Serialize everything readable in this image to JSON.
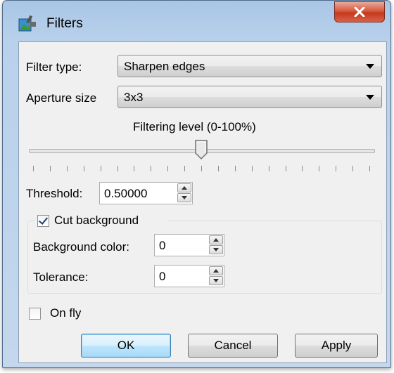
{
  "window": {
    "title": "Filters",
    "close_glyph": "X"
  },
  "filter_type": {
    "label": "Filter type:",
    "value": "Sharpen edges"
  },
  "aperture": {
    "label": "Aperture size",
    "value": "3x3"
  },
  "filtering_level": {
    "label": "Filtering level (0-100%)",
    "value_percent": 50,
    "tick_count": 20
  },
  "threshold": {
    "label": "Threshold:",
    "value": "0.50000"
  },
  "cut_background": {
    "label": "Cut background",
    "checked": true,
    "background_color": {
      "label": "Background color:",
      "value": "0"
    },
    "tolerance": {
      "label": "Tolerance:",
      "value": "0"
    }
  },
  "on_fly": {
    "label": "On fly",
    "checked": false
  },
  "buttons": {
    "ok": "OK",
    "cancel": "Cancel",
    "apply": "Apply"
  },
  "colors": {
    "accent": "#3c7fb1",
    "close": "#c43a1c",
    "titlebar": "#b9d1eb"
  }
}
